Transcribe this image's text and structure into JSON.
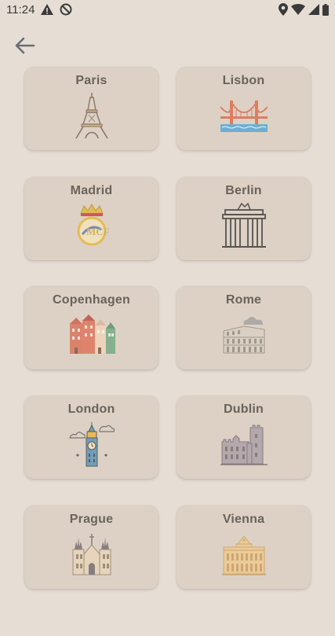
{
  "status_bar": {
    "time": "11:24",
    "left_icons": [
      "alert-triangle-icon",
      "do-not-disturb-icon"
    ],
    "right_icons": [
      "location-pin-icon",
      "wifi-icon",
      "cellular-signal-icon",
      "battery-icon"
    ]
  },
  "nav": {
    "back_icon": "arrow-left-icon"
  },
  "cities": [
    {
      "name": "Paris",
      "icon": "eiffel-tower-icon"
    },
    {
      "name": "Lisbon",
      "icon": "bridge-icon"
    },
    {
      "name": "Madrid",
      "icon": "real-madrid-crest-icon"
    },
    {
      "name": "Berlin",
      "icon": "brandenburg-gate-icon"
    },
    {
      "name": "Copenhagen",
      "icon": "colorful-houses-icon"
    },
    {
      "name": "Rome",
      "icon": "colosseum-icon"
    },
    {
      "name": "London",
      "icon": "big-ben-icon"
    },
    {
      "name": "Dublin",
      "icon": "castle-icon"
    },
    {
      "name": "Prague",
      "icon": "gothic-church-icon"
    },
    {
      "name": "Vienna",
      "icon": "palace-icon"
    }
  ],
  "colors": {
    "background": "#e6ddd4",
    "card": "#ddd1c5",
    "title_text": "#6a625b"
  }
}
